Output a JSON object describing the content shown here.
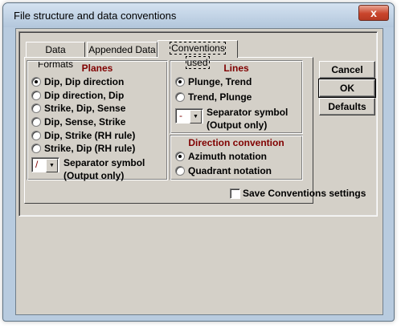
{
  "window": {
    "title": "File structure and data conventions",
    "close_glyph": "x"
  },
  "tabs": [
    {
      "label": "Data Formats",
      "active": false
    },
    {
      "label": "Appended Data",
      "active": false
    },
    {
      "label": "Conventions used",
      "active": true
    }
  ],
  "planes": {
    "title": "Planes",
    "options": [
      {
        "label": "Dip,  Dip direction",
        "checked": true
      },
      {
        "label": "Dip direction, Dip",
        "checked": false
      },
      {
        "label": "Strike, Dip, Sense",
        "checked": false
      },
      {
        "label": "Dip,  Sense,  Strike",
        "checked": false
      },
      {
        "label": "Dip, Strike (RH rule)",
        "checked": false
      },
      {
        "label": "Strike, Dip (RH rule)",
        "checked": false
      }
    ],
    "separator": {
      "value": "/",
      "label_line1": "Separator symbol",
      "label_line2": "(Output only)"
    }
  },
  "lines": {
    "title": "Lines",
    "options": [
      {
        "label": "Plunge, Trend",
        "checked": true
      },
      {
        "label": "Trend, Plunge",
        "checked": false
      }
    ],
    "separator": {
      "value": "-",
      "label_line1": "Separator symbol",
      "label_line2": "(Output only)"
    }
  },
  "direction": {
    "title": "Direction convention",
    "options": [
      {
        "label": "Azimuth notation",
        "checked": true
      },
      {
        "label": "Quadrant notation",
        "checked": false
      }
    ]
  },
  "buttons": {
    "cancel": "Cancel",
    "ok": "OK",
    "defaults": "Defaults"
  },
  "save_conventions": {
    "label": "Save Conventions settings",
    "checked": false
  },
  "colors": {
    "group_title": "#800000",
    "dialog_face": "#d4d0c8",
    "frame": "#b8cbdf"
  }
}
